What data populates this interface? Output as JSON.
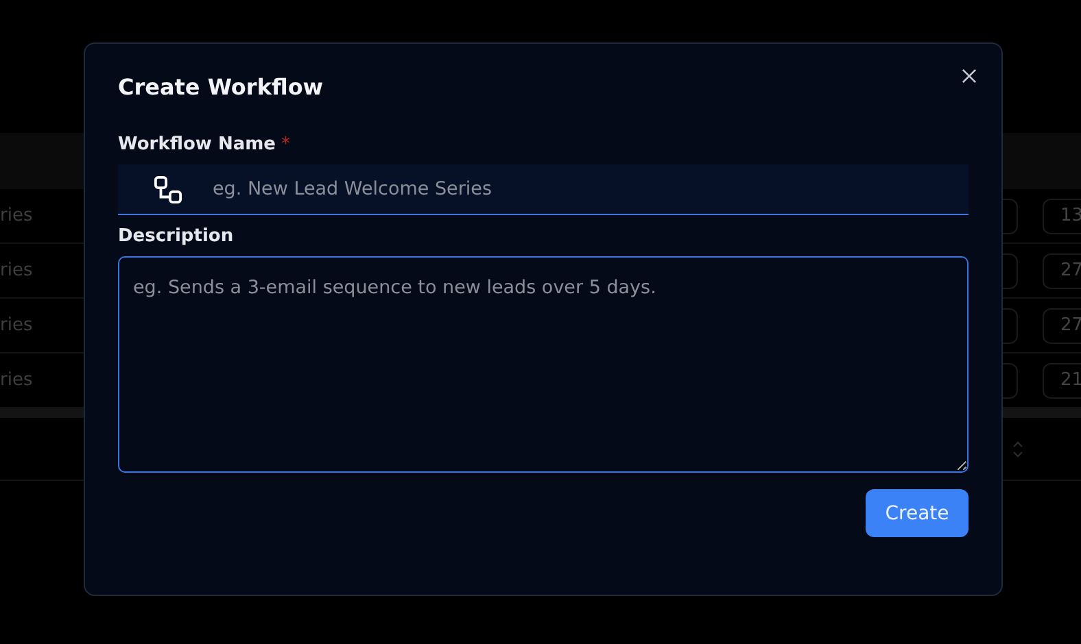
{
  "background_table": {
    "rows": [
      {
        "column_1": "ries",
        "column_2": "13"
      },
      {
        "column_1": "ries",
        "column_2": "27"
      },
      {
        "column_1": "ries",
        "column_2": "27"
      },
      {
        "column_1": "ries",
        "column_2": "21"
      }
    ]
  },
  "dialog": {
    "title": "Create Workflow",
    "fields": [
      {
        "kind": "input",
        "label": "Workflow Name",
        "required_mark": "*",
        "placeholder": "eg. New Lead Welcome Series"
      },
      {
        "kind": "textarea",
        "label": "Description",
        "placeholder": "eg. Sends a 3-email sequence to new leads over 5 days."
      }
    ],
    "button": "Create"
  }
}
